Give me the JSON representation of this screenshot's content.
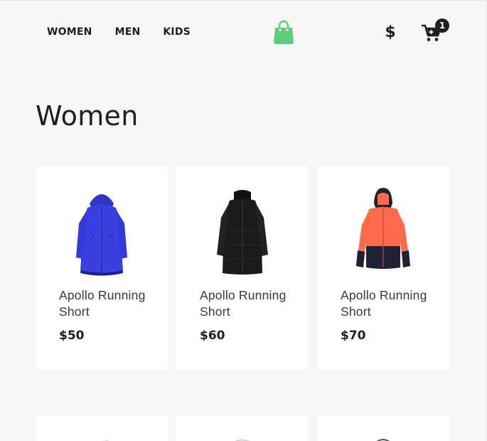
{
  "header": {
    "nav": [
      "WOMEN",
      "MEN",
      "KIDS"
    ],
    "logo_icon": "shopping-bag-icon",
    "logo_color": "#5ece7b",
    "currency_symbol": "$",
    "cart_icon": "cart-icon",
    "cart_count": "1"
  },
  "category": {
    "title": "Women"
  },
  "products": [
    {
      "name": "Apollo Running Short",
      "price": "$50",
      "image": "blue-jacket-image",
      "color": "#3a40e0"
    },
    {
      "name": "Apollo Running Short",
      "price": "$60",
      "image": "black-coat-image",
      "color": "#1b1b1b"
    },
    {
      "name": "Apollo Running Short",
      "price": "$70",
      "image": "orange-jacket-image",
      "color": "#ff6a4a"
    }
  ],
  "colors": {
    "background": "#f7f7f7",
    "card": "#ffffff",
    "text": "#1d1f22",
    "accent": "#5ece7b"
  }
}
